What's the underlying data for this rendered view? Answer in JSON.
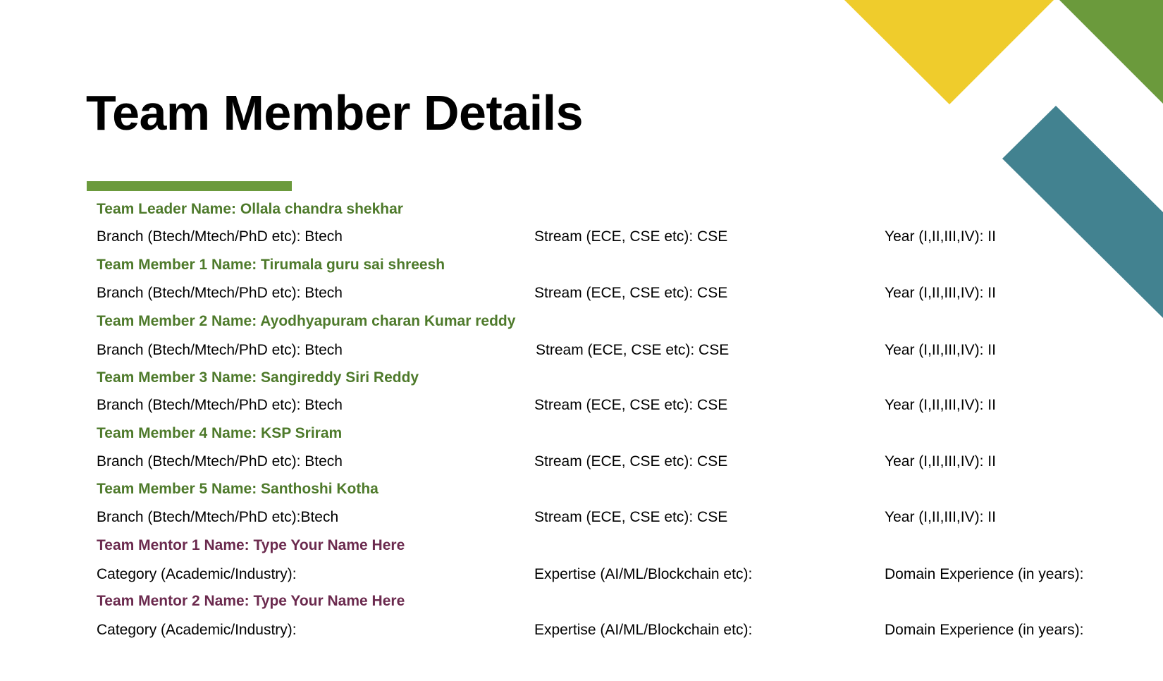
{
  "colors": {
    "accent_green": "#6b9a3c",
    "member_name_green": "#4e7a2b",
    "mentor_name_purple": "#6b2a4e",
    "deco_yellow": "#efcc2c",
    "deco_green": "#6b9a3c",
    "deco_teal": "#428290"
  },
  "title": "Team Member Details",
  "members": [
    {
      "name": "Team Leader Name: Ollala chandra shekhar",
      "branch": "Branch (Btech/Mtech/PhD etc): Btech",
      "stream": "Stream (ECE, CSE etc): CSE",
      "year": "Year (I,II,III,IV): II"
    },
    {
      "name": "Team Member 1 Name: Tirumala guru sai shreesh",
      "branch": "Branch (Btech/Mtech/PhD etc): Btech",
      "stream": "Stream (ECE, CSE etc): CSE",
      "year": "Year (I,II,III,IV): II"
    },
    {
      "name": "Team Member 2 Name: Ayodhyapuram charan Kumar reddy",
      "branch": "Branch (Btech/Mtech/PhD etc): Btech",
      "stream": "Stream (ECE, CSE etc): CSE",
      "year": "Year (I,II,III,IV):  II"
    },
    {
      "name": "Team Member 3 Name: Sangireddy Siri Reddy",
      "branch": "Branch (Btech/Mtech/PhD etc): Btech",
      "stream": "Stream (ECE, CSE etc): CSE",
      "year": "Year (I,II,III,IV):  II"
    },
    {
      "name": "Team Member 4 Name: KSP Sriram",
      "branch": "Branch (Btech/Mtech/PhD etc): Btech",
      "stream": "Stream (ECE, CSE etc): CSE",
      "year": "Year (I,II,III,IV): II"
    },
    {
      "name": "Team Member 5 Name: Santhoshi Kotha",
      "branch": "Branch (Btech/Mtech/PhD etc):Btech",
      "stream": "Stream (ECE, CSE etc): CSE",
      "year": "Year (I,II,III,IV):  II"
    }
  ],
  "mentors": [
    {
      "name": "Team Mentor 1 Name: Type Your Name Here",
      "category": "Category (Academic/Industry):",
      "expertise": "Expertise (AI/ML/Blockchain etc):",
      "experience": "Domain Experience (in years):"
    },
    {
      "name": "Team Mentor 2 Name: Type Your Name Here",
      "category": "Category (Academic/Industry):",
      "expertise": "Expertise (AI/ML/Blockchain etc):",
      "experience": "Domain Experience (in years):"
    }
  ]
}
